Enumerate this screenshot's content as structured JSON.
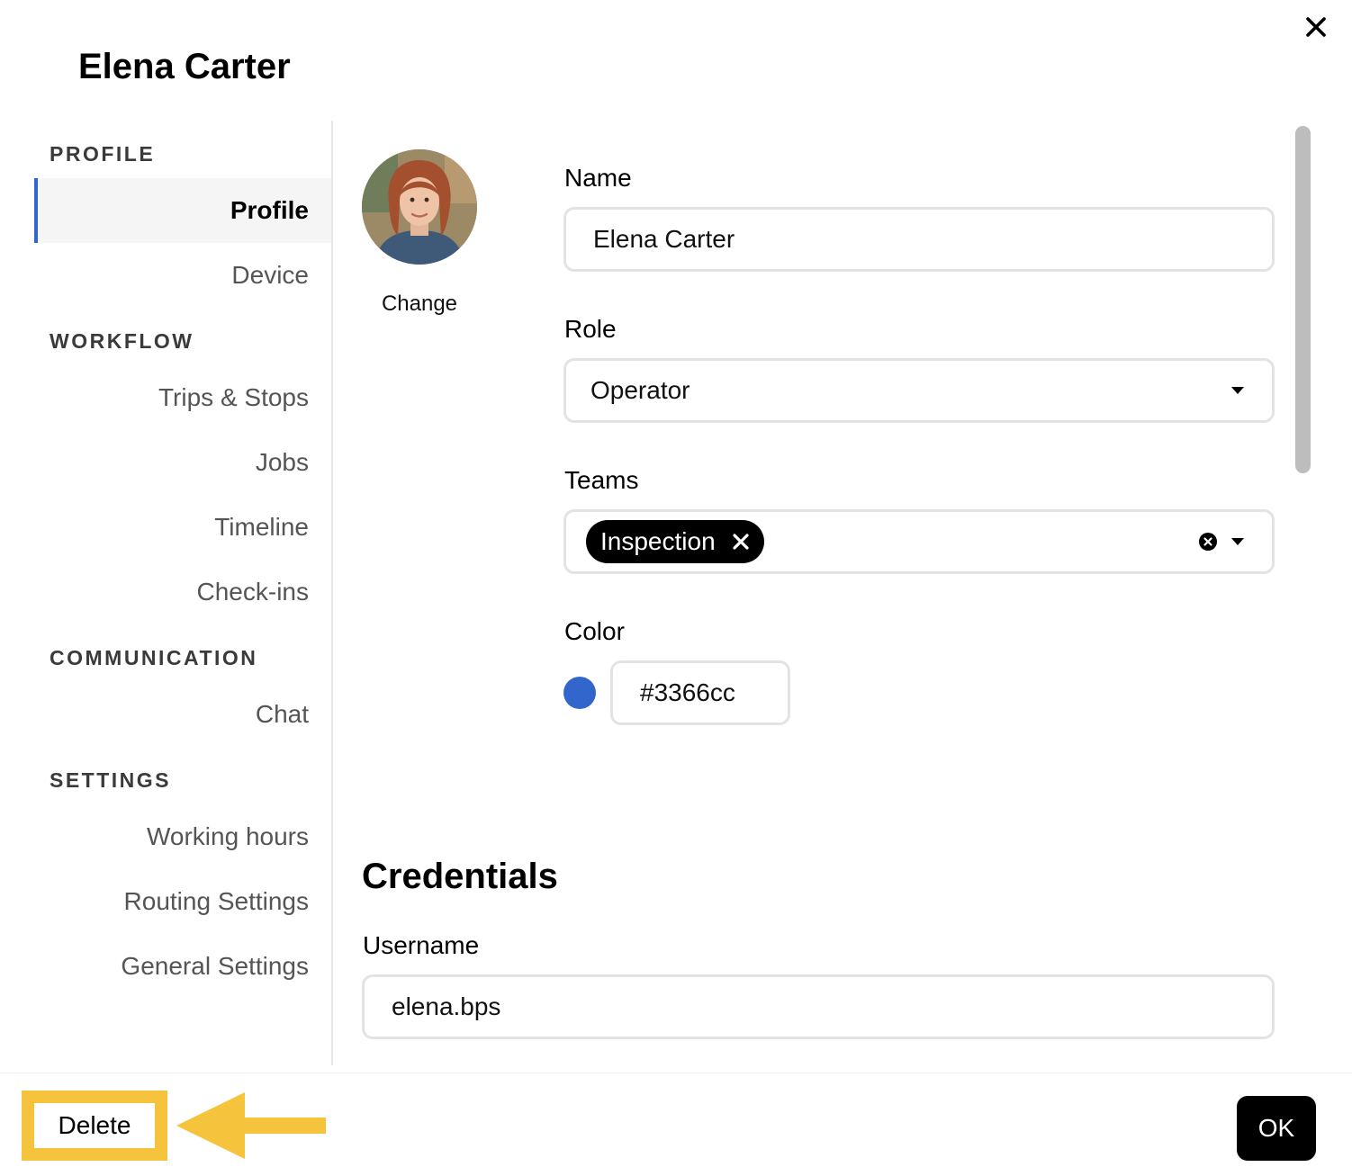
{
  "dialog": {
    "title": "Elena Carter",
    "close_icon": "close-icon"
  },
  "sidebar": {
    "sections": [
      {
        "label": "PROFILE",
        "items": [
          {
            "label": "Profile",
            "active": true
          },
          {
            "label": "Device"
          }
        ]
      },
      {
        "label": "WORKFLOW",
        "items": [
          {
            "label": "Trips & Stops"
          },
          {
            "label": "Jobs"
          },
          {
            "label": "Timeline"
          },
          {
            "label": "Check-ins"
          }
        ]
      },
      {
        "label": "COMMUNICATION",
        "items": [
          {
            "label": "Chat"
          }
        ]
      },
      {
        "label": "SETTINGS",
        "items": [
          {
            "label": "Working hours"
          },
          {
            "label": "Routing Settings"
          },
          {
            "label": "General Settings"
          }
        ]
      }
    ],
    "accent_color": "#3366cc"
  },
  "profile": {
    "avatar_icon": "avatar-photo",
    "change_label": "Change",
    "name": {
      "label": "Name",
      "value": "Elena Carter"
    },
    "role": {
      "label": "Role",
      "value": "Operator",
      "dropdown_icon": "caret-down-icon"
    },
    "teams": {
      "label": "Teams",
      "chips": [
        "Inspection"
      ],
      "clear_icon": "clear-circle-icon",
      "dropdown_icon": "caret-down-icon"
    },
    "color": {
      "label": "Color",
      "value": "#3366cc",
      "swatch": "#3366cc"
    }
  },
  "credentials": {
    "heading": "Credentials",
    "username": {
      "label": "Username",
      "value": "elena.bps"
    }
  },
  "footer": {
    "delete_label": "Delete",
    "ok_label": "OK",
    "highlight_color": "#f5c43c",
    "annotation_icon": "arrow-left-icon"
  }
}
